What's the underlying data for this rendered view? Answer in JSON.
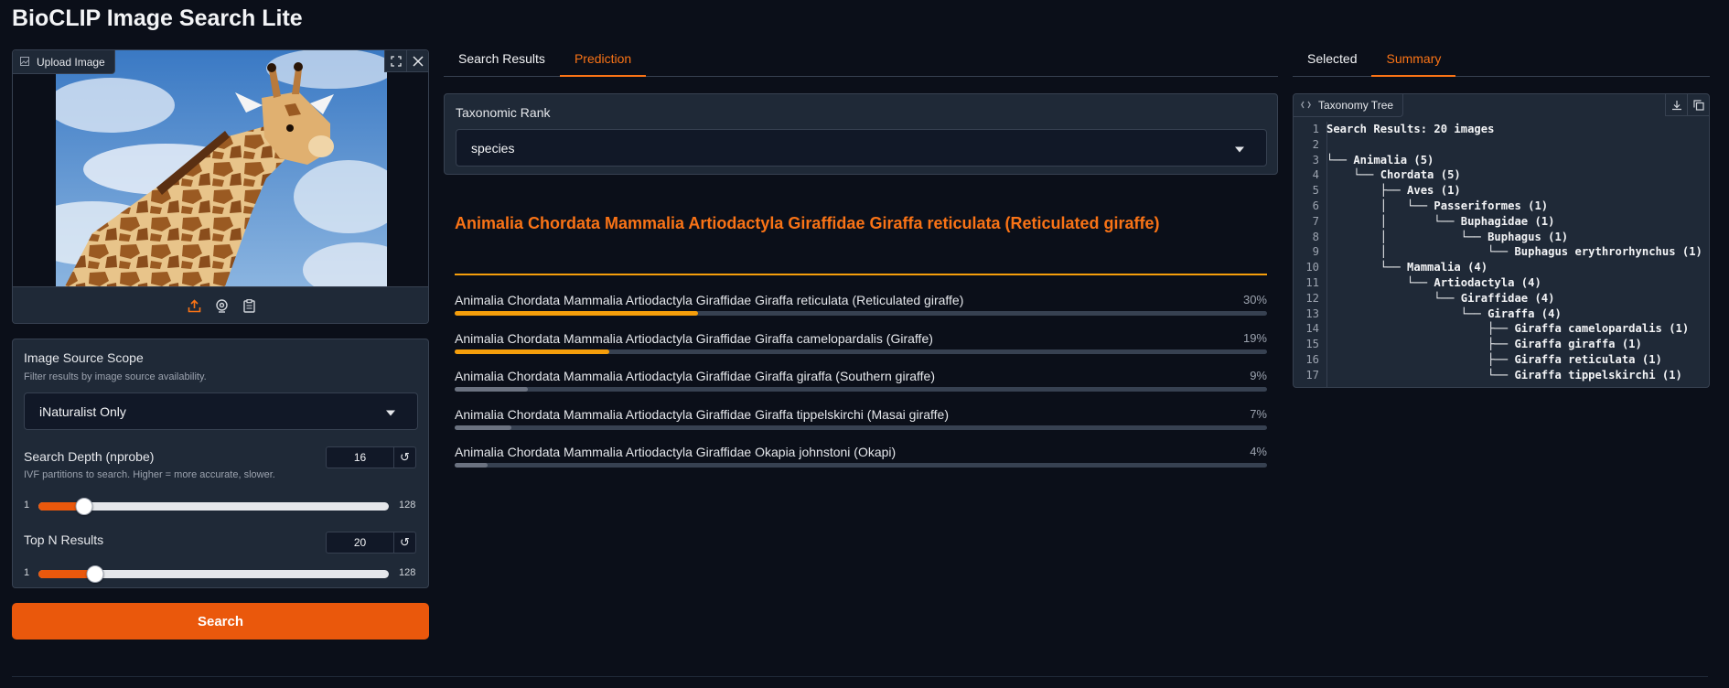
{
  "app": {
    "title": "BioCLIP Image Search Lite"
  },
  "upload": {
    "label": "Upload Image",
    "tools": [
      "fullscreen-icon",
      "close-icon"
    ],
    "actions": [
      "upload-icon",
      "webcam-icon",
      "clipboard-icon"
    ]
  },
  "filters": {
    "scope_label": "Image Source Scope",
    "scope_info": "Filter results by image source availability.",
    "scope_value": "iNaturalist Only",
    "depth_label": "Search Depth (nprobe)",
    "depth_info": "IVF partitions to search. Higher = more accurate, slower.",
    "depth_value": "16",
    "depth_min": "1",
    "depth_max": "128",
    "topn_label": "Top N Results",
    "topn_value": "20",
    "topn_min": "1",
    "topn_max": "128",
    "reset_glyph": "↺"
  },
  "search_button": "Search",
  "middle_tabs": [
    "Search Results",
    "Prediction"
  ],
  "rank": {
    "label": "Taxonomic Rank",
    "value": "species"
  },
  "prediction": {
    "top": "Animalia Chordata Mammalia Artiodactyla Giraffidae Giraffa reticulata (Reticulated giraffe)",
    "rows": [
      {
        "label": "Animalia Chordata Mammalia Artiodactyla Giraffidae Giraffa reticulata (Reticulated giraffe)",
        "pct": "30%",
        "value": 0.3
      },
      {
        "label": "Animalia Chordata Mammalia Artiodactyla Giraffidae Giraffa camelopardalis (Giraffe)",
        "pct": "19%",
        "value": 0.19
      },
      {
        "label": "Animalia Chordata Mammalia Artiodactyla Giraffidae Giraffa giraffa (Southern giraffe)",
        "pct": "9%",
        "value": 0.09
      },
      {
        "label": "Animalia Chordata Mammalia Artiodactyla Giraffidae Giraffa tippelskirchi (Masai giraffe)",
        "pct": "7%",
        "value": 0.07
      },
      {
        "label": "Animalia Chordata Mammalia Artiodactyla Giraffidae Okapia johnstoni (Okapi)",
        "pct": "4%",
        "value": 0.04
      }
    ],
    "colors": {
      "high": "#f59e0b",
      "low": "#6b7280"
    }
  },
  "right_tabs": [
    "Selected",
    "Summary"
  ],
  "tree": {
    "label": "Taxonomy Tree",
    "lines": [
      "Search Results: 20 images",
      "",
      "└── Animalia (5)",
      "    └── Chordata (5)",
      "        ├── Aves (1)",
      "        │   └── Passeriformes (1)",
      "        │       └── Buphagidae (1)",
      "        │           └── Buphagus (1)",
      "        │               └── Buphagus erythrorhynchus (1)",
      "        └── Mammalia (4)",
      "            └── Artiodactyla (4)",
      "                └── Giraffidae (4)",
      "                    └── Giraffa (4)",
      "                        ├── Giraffa camelopardalis (1)",
      "                        ├── Giraffa giraffa (1)",
      "                        ├── Giraffa reticulata (1)",
      "                        └── Giraffa tippelskirchi (1)"
    ]
  },
  "accent": "#ea580c"
}
